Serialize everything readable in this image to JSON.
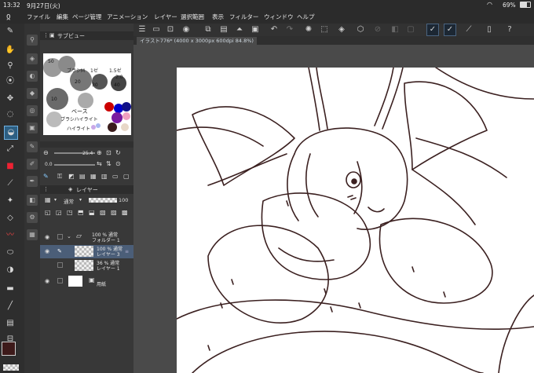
{
  "status": {
    "time": "13:32",
    "date": "9月27日(火)",
    "battery": "69%"
  },
  "menu": {
    "items": [
      "ファイル",
      "編集",
      "ページ管理",
      "アニメーション",
      "レイヤー",
      "選択範囲",
      "表示",
      "フィルター",
      "ウィンドウ",
      "ヘルプ"
    ]
  },
  "subview": {
    "tab": "サブビュー"
  },
  "canvas": {
    "tab": "イラスト776* (4000 x 3000px 600dpi 84.8%)"
  },
  "brush": {
    "size": "25.4",
    "opacity": "0.0"
  },
  "layers": {
    "tab": "レイヤー",
    "blend_mode": "通常",
    "opacity": "100",
    "rows": [
      {
        "percent": "100 %  通常",
        "name": "フォルダー 1"
      },
      {
        "percent": "100 %  通常",
        "name": "レイヤー 3"
      },
      {
        "percent": "36 %  通常",
        "name": "レイヤー 1"
      },
      {
        "percent": "",
        "name": "用紙"
      }
    ]
  },
  "palette_ref": {
    "notes": [
      "ブラシM",
      "1ゼ",
      "1.5ゼ",
      "2.0",
      "50",
      "10",
      "20",
      "30",
      "40",
      "ベース",
      "ブラシハイライト",
      "ハイライト"
    ]
  },
  "colors": {
    "main": "#3d1a1a",
    "sub": "#ffffff",
    "accent": "#3c6fb0"
  }
}
